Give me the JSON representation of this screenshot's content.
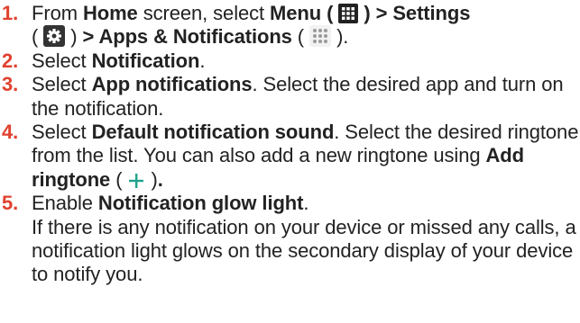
{
  "accent_color": "#e0412e",
  "plus_color": "#1fa28c",
  "steps": [
    {
      "number": "1.",
      "t_from": "From ",
      "home": "Home",
      "t_screen": " screen, select ",
      "menu": "Menu (",
      "menu_close": ") > Settings",
      "open1": "(",
      "close1": ") ",
      "apps": "> Apps & Notifications",
      "open2": " (",
      "close2": ").",
      "icons": [
        "menu-grid-icon",
        "settings-gear-icon",
        "apps-dots-icon"
      ]
    },
    {
      "number": "2.",
      "t_select": "Select ",
      "notification": "Notification",
      "end": "."
    },
    {
      "number": "3.",
      "t_select": "Select ",
      "app_notifications": "App notifications",
      "rest": ". Select the desired app and turn on the notification."
    },
    {
      "number": "4.",
      "t_select": "Select ",
      "default_sound": "Default notification sound",
      "rest": ". Select the desired ringtone from the list. You can also add a new ringtone using ",
      "add_ringtone": "Add ringtone",
      "open": " (",
      "close": ")",
      "end": ".",
      "icon": "plus-icon"
    },
    {
      "number": "5.",
      "t_enable": "Enable ",
      "glow_light": "Notification glow light",
      "end": ".",
      "description": "If there is any notification on your device or missed any calls, a notification light glows on the secondary display of your device to notify you."
    }
  ]
}
